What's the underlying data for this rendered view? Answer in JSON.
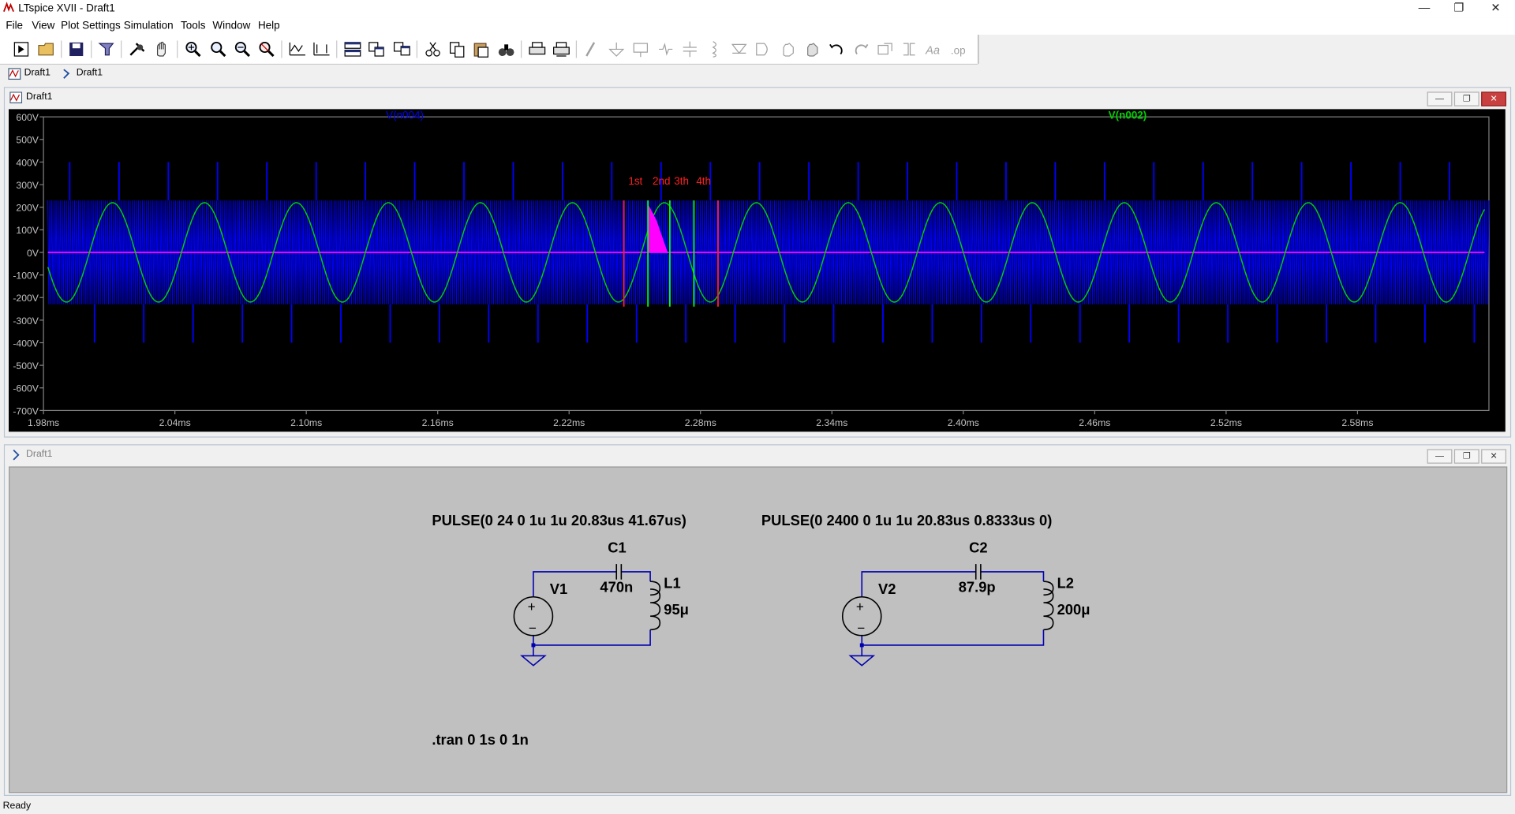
{
  "window": {
    "title": "LTspice XVII - Draft1",
    "min_glyph": "—",
    "max_glyph": "❐",
    "close_glyph": "✕"
  },
  "menu": {
    "items": [
      "File",
      "View",
      "Plot Settings",
      "Simulation",
      "Tools",
      "Window",
      "Help"
    ]
  },
  "tabs": [
    {
      "label": "Draft1",
      "icon": "waveform-icon"
    },
    {
      "label": "Draft1",
      "icon": "schematic-icon"
    }
  ],
  "plot_window": {
    "title": "Draft1"
  },
  "schematic_window": {
    "title": "Draft1"
  },
  "status": {
    "text": "Ready"
  },
  "chart_data": {
    "type": "line",
    "x_unit": "ms",
    "xlim": [
      1.98,
      2.64
    ],
    "ylim": [
      -700,
      600
    ],
    "xticks": [
      "1.98ms",
      "2.04ms",
      "2.10ms",
      "2.16ms",
      "2.22ms",
      "2.28ms",
      "2.34ms",
      "2.40ms",
      "2.46ms",
      "2.52ms",
      "2.58ms"
    ],
    "yticks": [
      "600V",
      "500V",
      "400V",
      "300V",
      "200V",
      "100V",
      "0V",
      "-100V",
      "-200V",
      "-300V",
      "-400V",
      "-500V",
      "-600V",
      "-700V"
    ],
    "grid": false,
    "background": "#000000",
    "series": [
      {
        "name": "V(n004)",
        "color": "#0000ff",
        "kind": "dense-oscillation",
        "envelope": [
          -230,
          230
        ],
        "spike_peak": 400,
        "spike_period_ms": 0.0225
      },
      {
        "name": "V(n002)",
        "color": "#00d000",
        "kind": "sine",
        "amplitude": 220,
        "period_ms": 0.042
      },
      {
        "name": "",
        "color": "#ff00ff",
        "kind": "flat",
        "value": 0
      }
    ],
    "annotations": [
      {
        "text": "1st",
        "color": "#ff2020"
      },
      {
        "text": "2nd",
        "color": "#ff2020"
      },
      {
        "text": "3th",
        "color": "#ff2020"
      },
      {
        "text": "4th",
        "color": "#ff2020"
      }
    ],
    "markers": [
      {
        "x": 2.245,
        "color": "#ff2020"
      },
      {
        "x": 2.256,
        "color": "#00ff00"
      },
      {
        "x": 2.266,
        "color": "#00ff00"
      },
      {
        "x": 2.277,
        "color": "#00ff00"
      },
      {
        "x": 2.288,
        "color": "#ff2020"
      }
    ]
  },
  "schematic": {
    "pulse1": "PULSE(0 24 0 1u 1u 20.83us 41.67us)",
    "pulse2": "PULSE(0 2400 0 1u 1u 20.83us 0.8333us 0)",
    "v1": "V1",
    "c1": "C1",
    "c1_val": "470n",
    "l1": "L1",
    "l1_val": "95μ",
    "v2": "V2",
    "c2": "C2",
    "c2_val": "87.9p",
    "l2": "L2",
    "l2_val": "200μ",
    "plus": "+",
    "minus": "−",
    "tran": ".tran 0 1s 0 1n",
    "wire_color": "#0000b0",
    "text_color": "#000000"
  }
}
